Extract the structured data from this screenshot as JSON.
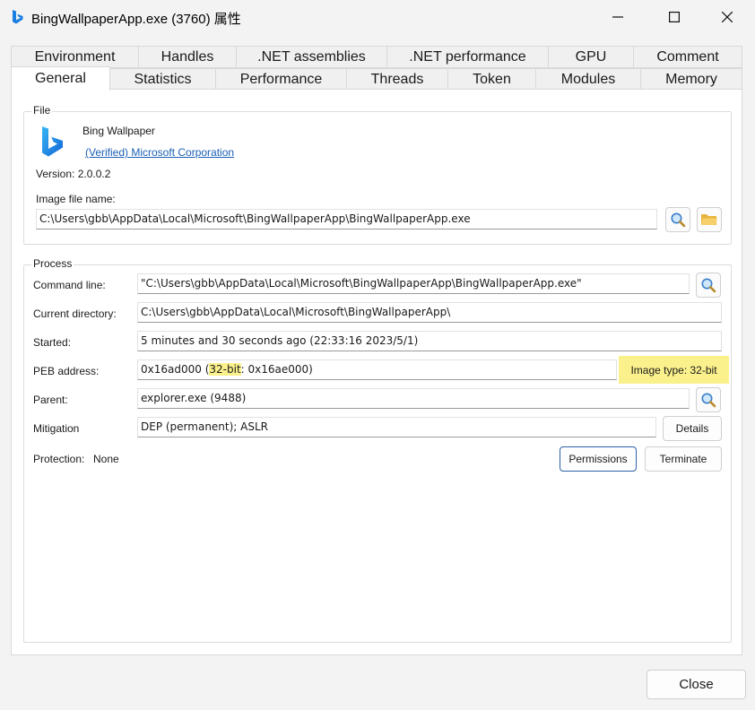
{
  "window": {
    "title": "BingWallpaperApp.exe (3760) 属性"
  },
  "tabs": {
    "row1": [
      "Environment",
      "Handles",
      ".NET assemblies",
      ".NET performance",
      "GPU",
      "Comment"
    ],
    "row2": [
      "General",
      "Statistics",
      "Performance",
      "Threads",
      "Token",
      "Modules",
      "Memory"
    ],
    "selected": "General"
  },
  "file": {
    "group_label": "File",
    "app_name": "Bing Wallpaper",
    "publisher": "(Verified) Microsoft Corporation",
    "version": "Version: 2.0.0.2",
    "image_file_label": "Image file name:",
    "image_file_value": "C:\\Users\\gbb\\AppData\\Local\\Microsoft\\BingWallpaperApp\\BingWallpaperApp.exe"
  },
  "process": {
    "group_label": "Process",
    "command_line_label": "Command line:",
    "command_line_value": "\"C:\\Users\\gbb\\AppData\\Local\\Microsoft\\BingWallpaperApp\\BingWallpaperApp.exe\"",
    "current_dir_label": "Current directory:",
    "current_dir_value": "C:\\Users\\gbb\\AppData\\Local\\Microsoft\\BingWallpaperApp\\",
    "started_label": "Started:",
    "started_value": "5 minutes and 30 seconds ago (22:33:16 2023/5/1)",
    "peb_label": "PEB address:",
    "peb_prefix": "0x16ad000 (",
    "peb_highlight": "32-bit",
    "peb_suffix": ": 0x16ae000)",
    "image_type": "Image type: 32-bit",
    "parent_label": "Parent:",
    "parent_value": "explorer.exe (9488)",
    "mitigation_label": "Mitigation",
    "mitigation_value": "DEP (permanent); ASLR",
    "details_button": "Details",
    "protection_label": "Protection:",
    "protection_value": "None",
    "permissions_button": "Permissions",
    "terminate_button": "Terminate"
  },
  "footer": {
    "close_button": "Close"
  },
  "colors": {
    "highlight": "#fbf18c",
    "link": "#1a5fb4",
    "bing_blue": "#1a7fe0"
  }
}
